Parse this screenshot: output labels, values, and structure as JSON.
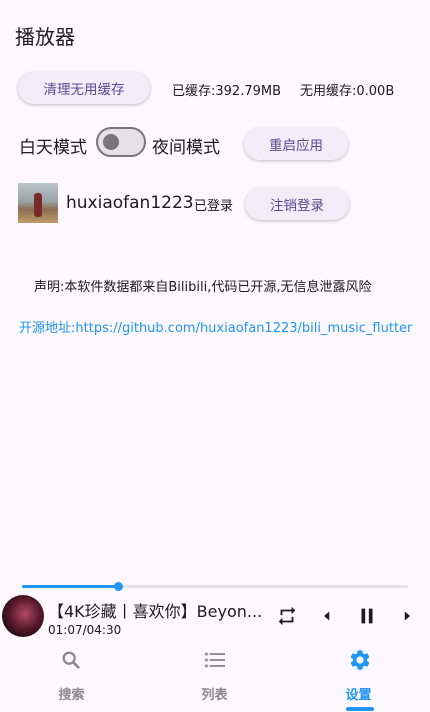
{
  "app": {
    "title": "播放器"
  },
  "cache": {
    "clear_button": "清理无用缓存",
    "cached_text": "已缓存:392.79MB",
    "unused_text": "无用缓存:0.00B"
  },
  "theme": {
    "day_label": "白天模式",
    "night_label": "夜间模式",
    "night_mode_on": false,
    "restart_button": "重启应用"
  },
  "account": {
    "username": "huxiaofan1223",
    "status": "已登录",
    "logout_button": "注销登录"
  },
  "notice": {
    "disclaimer": "声明:本软件数据都来自Bilibili,代码已开源,无信息泄露风险",
    "source_link": "开源地址:https://github.com/huxiaofan1223/bili_music_flutter"
  },
  "now_playing": {
    "title": "【4K珍藏丨喜欢你】Beyon...",
    "time": "01:07/04:30",
    "progress_fraction": 0.248,
    "controls": [
      "repeat-icon",
      "previous-icon",
      "pause-icon",
      "next-icon"
    ]
  },
  "bottom_nav": {
    "items": [
      {
        "label": "搜索",
        "icon": "search-icon",
        "active": false
      },
      {
        "label": "列表",
        "icon": "list-icon",
        "active": false
      },
      {
        "label": "设置",
        "icon": "gear-icon",
        "active": true
      }
    ]
  },
  "colors": {
    "accent": "#2196f3",
    "button_text": "#5a4a93",
    "background": "#fdf7ff"
  }
}
